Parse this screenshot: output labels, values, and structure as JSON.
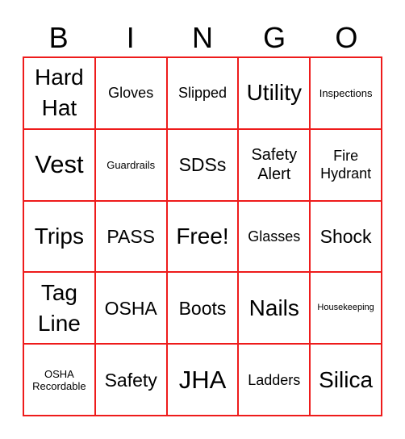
{
  "title_letters": [
    "B",
    "I",
    "N",
    "G",
    "O"
  ],
  "accent_color": "#ee1b1b",
  "cells": [
    [
      {
        "text": "Hard Hat",
        "size": "s6"
      },
      {
        "text": "Gloves",
        "size": "s3"
      },
      {
        "text": "Slipped",
        "size": "s3"
      },
      {
        "text": "Utility",
        "size": "s6"
      },
      {
        "text": "Inspections",
        "size": "s1"
      }
    ],
    [
      {
        "text": "Vest",
        "size": "s7"
      },
      {
        "text": "Guardrails",
        "size": "s1"
      },
      {
        "text": "SDSs",
        "size": "s5"
      },
      {
        "text": "Safety Alert",
        "size": "s4"
      },
      {
        "text": "Fire Hydrant",
        "size": "s3"
      }
    ],
    [
      {
        "text": "Trips",
        "size": "s6"
      },
      {
        "text": "PASS",
        "size": "s5"
      },
      {
        "text": "Free!",
        "size": "s6"
      },
      {
        "text": "Glasses",
        "size": "s3"
      },
      {
        "text": "Shock",
        "size": "s5"
      }
    ],
    [
      {
        "text": "Tag Line",
        "size": "s6"
      },
      {
        "text": "OSHA",
        "size": "s5"
      },
      {
        "text": "Boots",
        "size": "s5"
      },
      {
        "text": "Nails",
        "size": "s6"
      },
      {
        "text": "Housekeeping",
        "size": "s2"
      }
    ],
    [
      {
        "text": "OSHA Recordable",
        "size": "s1"
      },
      {
        "text": "Safety",
        "size": "s5"
      },
      {
        "text": "JHA",
        "size": "s7"
      },
      {
        "text": "Ladders",
        "size": "s3"
      },
      {
        "text": "Silica",
        "size": "s6"
      }
    ]
  ]
}
